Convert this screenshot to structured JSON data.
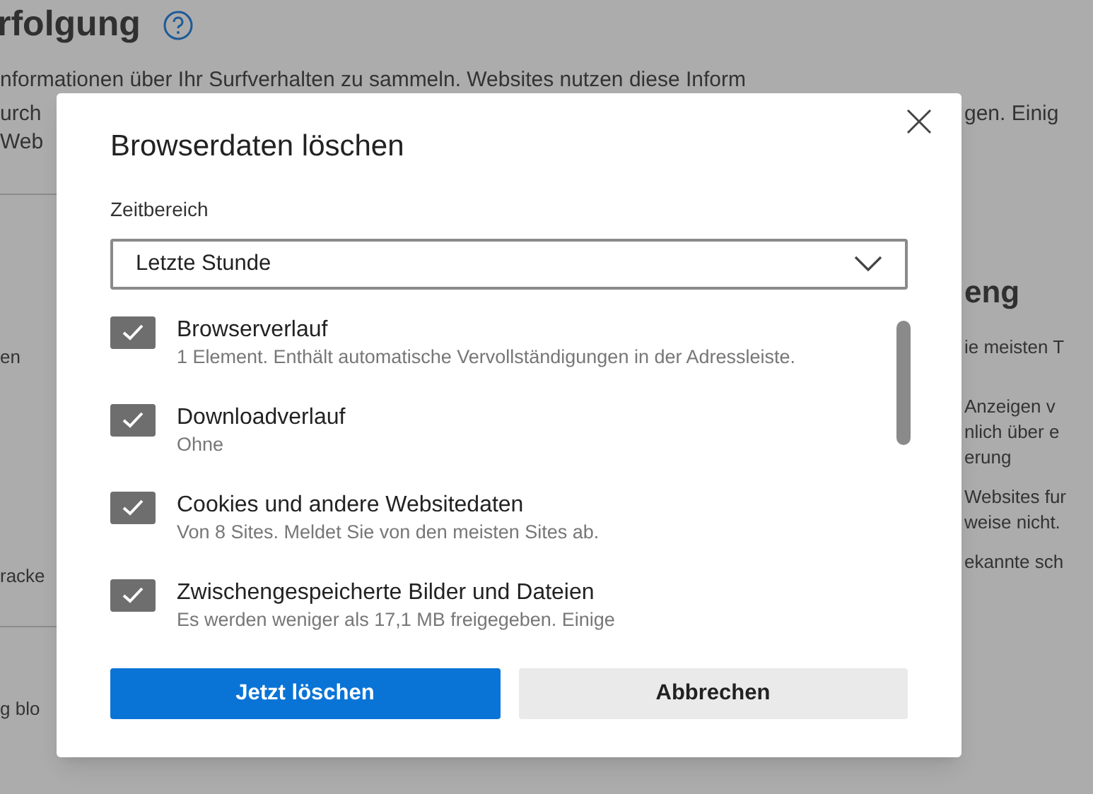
{
  "background": {
    "title": "rfolgung",
    "intro": "nformationen über Ihr Surfverhalten zu sammeln. Websites nutzen diese Inform",
    "left_top": [
      "urch",
      "Web"
    ],
    "right_top": [
      "gen. Einig"
    ],
    "left_lower": [
      "en",
      "racke",
      "g blo"
    ],
    "right_heading": "eng",
    "right_lower": [
      [
        "ie meisten T"
      ],
      [
        "Anzeigen v",
        "nlich über e",
        "erung"
      ],
      [
        "Websites fur",
        "weise nicht."
      ],
      [
        "ekannte sch"
      ]
    ]
  },
  "dialog": {
    "title": "Browserdaten löschen",
    "time_range_label": "Zeitbereich",
    "time_range_value": "Letzte Stunde",
    "items": [
      {
        "label": "Browserverlauf",
        "description": "1 Element. Enthält automatische Vervollständigungen in der Adressleiste.",
        "checked": true
      },
      {
        "label": "Downloadverlauf",
        "description": "Ohne",
        "checked": true
      },
      {
        "label": "Cookies und andere Websitedaten",
        "description": "Von 8 Sites. Meldet Sie von den meisten Sites ab.",
        "checked": true
      },
      {
        "label": "Zwischengespeicherte Bilder und Dateien",
        "description": "Es werden weniger als 17,1 MB freigegeben. Einige",
        "checked": true
      }
    ],
    "primary_button": "Jetzt löschen",
    "secondary_button": "Abbrechen"
  }
}
